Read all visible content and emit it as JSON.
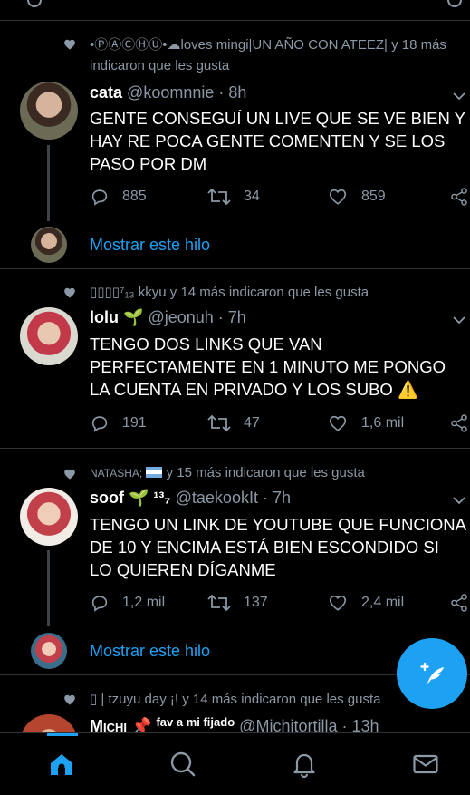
{
  "tweets": [
    {
      "social": "•ⓅⒶⒸⒽⓊ•☁loves mingi|UN AÑO CON ATEEZ| y 18 más",
      "social2": "indicaron que les gusta",
      "name": "cata",
      "handle": "@koomnnie · 8h",
      "text": "GENTE CONSEGUÍ UN LIVE QUE SE VE BIEN Y HAY RE POCA GENTE COMENTEN Y SE LOS PASO POR DM",
      "replies": "885",
      "retweets": "34",
      "likes": "859",
      "show_thread": "Mostrar este hilo"
    },
    {
      "social": "▯▯▯▯⁷₁₃ kkyu y 14 más indicaron que les gusta",
      "name": "lolu",
      "name_suffix": "🌱",
      "handle": "@jeonuh · 7h",
      "text": "TENGO DOS LINKS QUE VAN PERFECTAMENTE EN 1 MINUTO ME PONGO LA CUENTA EN PRIVADO Y LOS SUBO ⚠️",
      "replies": "191",
      "retweets": "47",
      "likes": "1,6 mil"
    },
    {
      "social_name": "NATASHA;",
      "social": "y 15 más indicaron que les gusta",
      "name": "soof",
      "name_suffix": "🌱 ¹³₇",
      "handle": "@taekookIt · 7h",
      "text": "TENGO UN LINK DE YOUTUBE QUE FUNCIONA DE 10 Y ENCIMA ESTÁ BIEN ESCONDIDO SI LO QUIEREN DÍGANME",
      "replies": "1,2 mil",
      "retweets": "137",
      "likes": "2,4 mil",
      "show_thread": "Mostrar este hilo"
    },
    {
      "social": "▯ | tzuyu day ¡! y 14 más indicaron que les gusta",
      "name": "Michi",
      "name_suffix": "📌",
      "name_tag": "fav a mi fijado",
      "handle": "@Michitortilla · 13h"
    }
  ],
  "colors": {
    "accent": "#1da1f2",
    "muted": "#8b98a5",
    "divider": "#2f3336",
    "background": "#000000"
  },
  "nav": [
    "home-icon",
    "search-icon",
    "notifications-icon",
    "messages-icon"
  ]
}
